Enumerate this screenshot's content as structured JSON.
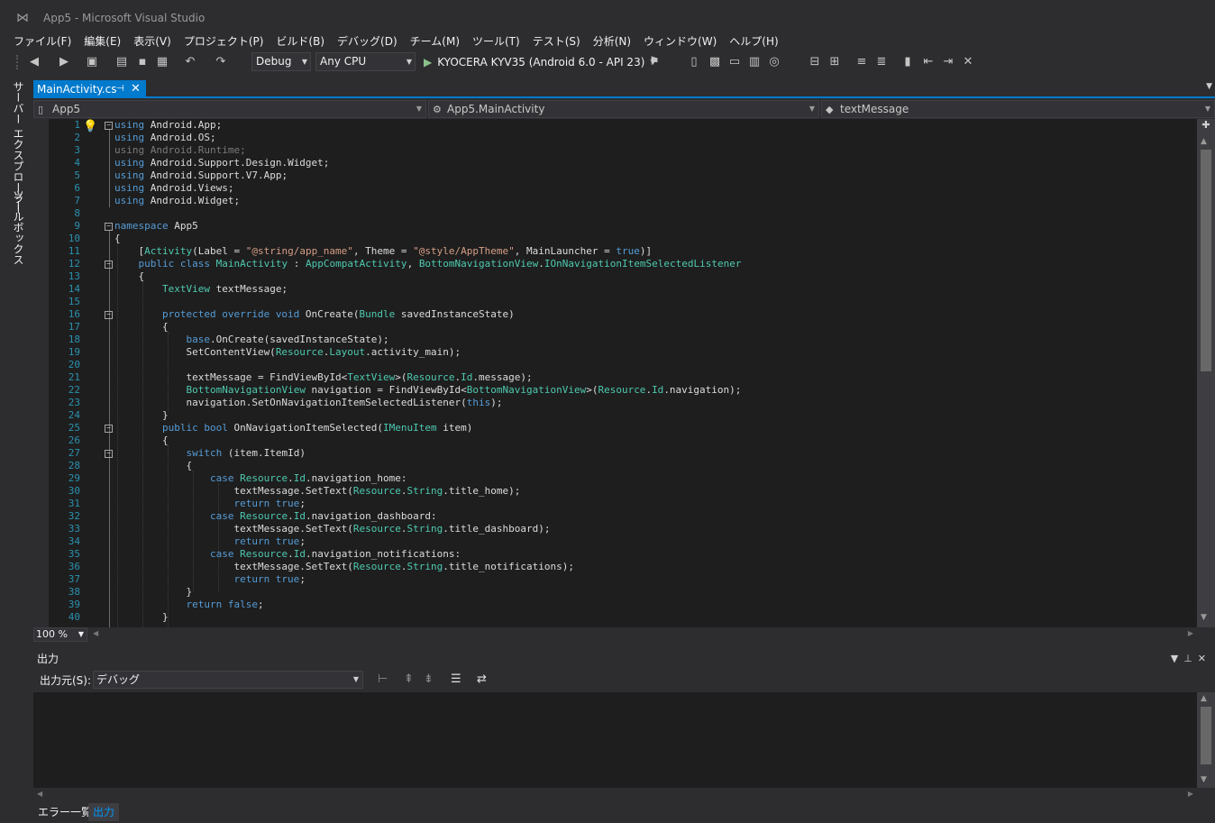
{
  "window": {
    "title": "App5 - Microsoft Visual Studio"
  },
  "menu": [
    "ファイル(F)",
    "編集(E)",
    "表示(V)",
    "プロジェクト(P)",
    "ビルド(B)",
    "デバッグ(D)",
    "チーム(M)",
    "ツール(T)",
    "テスト(S)",
    "分析(N)",
    "ウィンドウ(W)",
    "ヘルプ(H)"
  ],
  "toolbar": {
    "configuration": "Debug",
    "platform": "Any CPU",
    "run_target": "KYOCERA KYV35 (Android 6.0 - API 23)"
  },
  "side_tabs": [
    "サーバー エクスプローラー",
    "ツールボックス"
  ],
  "document_tab": {
    "label": "MainActivity.cs",
    "pin": "⊣",
    "close": "✕"
  },
  "navigation": {
    "project": "App5",
    "type": "App5.MainActivity",
    "member": "textMessage"
  },
  "code_lines": [
    {
      "n": "1",
      "html": "<span class=\"kw\">using</span> Android.App;"
    },
    {
      "n": "2",
      "html": "<span class=\"kw\">using</span> Android.OS;"
    },
    {
      "n": "3",
      "html": "<span class=\"unused\">using Android.Runtime;</span>"
    },
    {
      "n": "4",
      "html": "<span class=\"kw\">using</span> Android.Support.Design.Widget;"
    },
    {
      "n": "5",
      "html": "<span class=\"kw\">using</span> Android.Support.V7.App;"
    },
    {
      "n": "6",
      "html": "<span class=\"kw\">using</span> Android.Views;"
    },
    {
      "n": "7",
      "html": "<span class=\"kw\">using</span> Android.Widget;"
    },
    {
      "n": "8",
      "html": ""
    },
    {
      "n": "9",
      "html": "<span class=\"kw\">namespace</span> App5"
    },
    {
      "n": "10",
      "html": "{"
    },
    {
      "n": "11",
      "html": "    [<span class=\"ty\">Activity</span>(Label = <span class=\"str\">\"@string/app_name\"</span>, Theme = <span class=\"str\">\"@style/AppTheme\"</span>, MainLauncher = <span class=\"kw\">true</span>)]"
    },
    {
      "n": "12",
      "html": "    <span class=\"kw\">public class</span> <span class=\"ty\">MainActivity</span> : <span class=\"ty\">AppCompatActivity</span>, <span class=\"ty\">BottomNavigationView</span>.<span class=\"ty\">IOnNavigationItemSelectedListener</span>"
    },
    {
      "n": "13",
      "html": "    {"
    },
    {
      "n": "14",
      "html": "        <span class=\"ty\">TextView</span> textMessage;"
    },
    {
      "n": "15",
      "html": ""
    },
    {
      "n": "16",
      "html": "        <span class=\"kw\">protected override void</span> OnCreate(<span class=\"ty\">Bundle</span> savedInstanceState)"
    },
    {
      "n": "17",
      "html": "        {"
    },
    {
      "n": "18",
      "html": "            <span class=\"kw\">base</span>.OnCreate(savedInstanceState);"
    },
    {
      "n": "19",
      "html": "            SetContentView(<span class=\"ty\">Resource</span>.<span class=\"ty\">Layout</span>.activity_main);"
    },
    {
      "n": "20",
      "html": ""
    },
    {
      "n": "21",
      "html": "            textMessage = FindViewById&lt;<span class=\"ty\">TextView</span>&gt;(<span class=\"ty\">Resource</span>.<span class=\"ty\">Id</span>.message);"
    },
    {
      "n": "22",
      "html": "            <span class=\"ty\">BottomNavigationView</span> navigation = FindViewById&lt;<span class=\"ty\">BottomNavigationView</span>&gt;(<span class=\"ty\">Resource</span>.<span class=\"ty\">Id</span>.navigation);"
    },
    {
      "n": "23",
      "html": "            navigation.SetOnNavigationItemSelectedListener(<span class=\"kw\">this</span>);"
    },
    {
      "n": "24",
      "html": "        }"
    },
    {
      "n": "25",
      "html": "        <span class=\"kw\">public bool</span> OnNavigationItemSelected(<span class=\"ty\">IMenuItem</span> item)"
    },
    {
      "n": "26",
      "html": "        {"
    },
    {
      "n": "27",
      "html": "            <span class=\"kw\">switch</span> (item.ItemId)"
    },
    {
      "n": "28",
      "html": "            {"
    },
    {
      "n": "29",
      "html": "                <span class=\"kw\">case</span> <span class=\"ty\">Resource</span>.<span class=\"ty\">Id</span>.navigation_home:"
    },
    {
      "n": "30",
      "html": "                    textMessage.SetText(<span class=\"ty\">Resource</span>.<span class=\"ty\">String</span>.title_home);"
    },
    {
      "n": "31",
      "html": "                    <span class=\"kw\">return true</span>;"
    },
    {
      "n": "32",
      "html": "                <span class=\"kw\">case</span> <span class=\"ty\">Resource</span>.<span class=\"ty\">Id</span>.navigation_dashboard:"
    },
    {
      "n": "33",
      "html": "                    textMessage.SetText(<span class=\"ty\">Resource</span>.<span class=\"ty\">String</span>.title_dashboard);"
    },
    {
      "n": "34",
      "html": "                    <span class=\"kw\">return true</span>;"
    },
    {
      "n": "35",
      "html": "                <span class=\"kw\">case</span> <span class=\"ty\">Resource</span>.<span class=\"ty\">Id</span>.navigation_notifications:"
    },
    {
      "n": "36",
      "html": "                    textMessage.SetText(<span class=\"ty\">Resource</span>.<span class=\"ty\">String</span>.title_notifications);"
    },
    {
      "n": "37",
      "html": "                    <span class=\"kw\">return true</span>;"
    },
    {
      "n": "38",
      "html": "            }"
    },
    {
      "n": "39",
      "html": "            <span class=\"kw\">return false</span>;"
    },
    {
      "n": "40",
      "html": "        }"
    }
  ],
  "fold_lines": [
    "1",
    "9",
    "12",
    "16",
    "25",
    "27"
  ],
  "zoom": "100 %",
  "output": {
    "title": "出力",
    "source_label": "出力元(S):",
    "source_value": "デバッグ"
  },
  "bottom_tabs": [
    "エラー一覧",
    "出力"
  ],
  "colors": {
    "accent": "#007acc",
    "background": "#2d2d30",
    "editor": "#1e1e1e",
    "keyword": "#569cd6",
    "type": "#4ec9b0",
    "string": "#d69d85",
    "line_number": "#2b91af"
  }
}
